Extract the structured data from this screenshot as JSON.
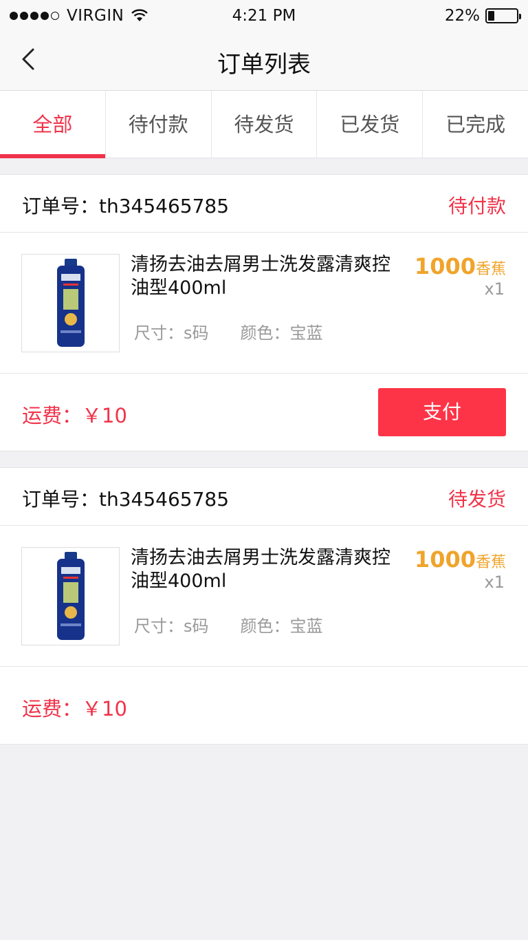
{
  "status_bar": {
    "carrier": "VIRGIN",
    "time": "4:21 PM",
    "battery": "22%"
  },
  "nav": {
    "title": "订单列表"
  },
  "tabs": [
    {
      "label": "全部"
    },
    {
      "label": "待付款"
    },
    {
      "label": "待发货"
    },
    {
      "label": "已发货"
    },
    {
      "label": "已完成"
    }
  ],
  "orders": [
    {
      "order_label": "订单号：th345465785",
      "status": "待付款",
      "product": {
        "name": "清扬去油去屑男士洗发露清爽控油型400ml",
        "size": "尺寸：s码",
        "color": "颜色：宝蓝",
        "price": "1000",
        "price_unit": "香蕉",
        "qty": "x1"
      },
      "shipping": "运费：￥10",
      "pay_label": "支付"
    },
    {
      "order_label": "订单号：th345465785",
      "status": "待发货",
      "product": {
        "name": "清扬去油去屑男士洗发露清爽控油型400ml",
        "size": "尺寸：s码",
        "color": "颜色：宝蓝",
        "price": "1000",
        "price_unit": "香蕉",
        "qty": "x1"
      },
      "shipping": "运费：￥10"
    }
  ],
  "colors": {
    "accent": "#f0334a",
    "price": "#f0a42b"
  }
}
